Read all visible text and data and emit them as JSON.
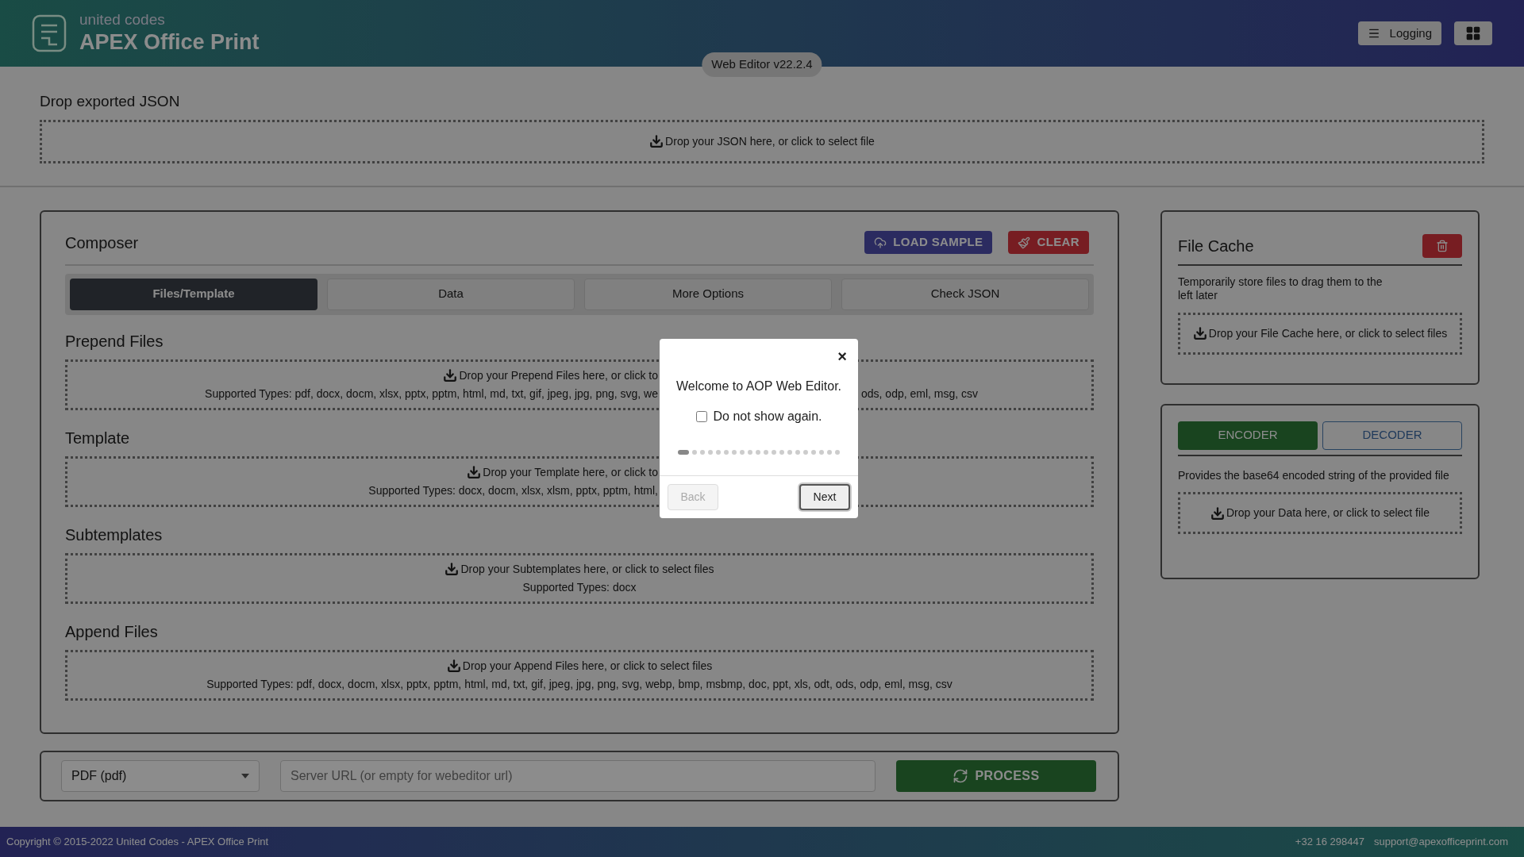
{
  "header": {
    "brand_top": "united codes",
    "brand_name": "APEX Office Print",
    "buttons": [
      {
        "kind": "menu",
        "label": "Logging"
      },
      {
        "kind": "grid"
      }
    ],
    "version": "Web Editor v22.2.4"
  },
  "json_drop": {
    "title": "Drop exported JSON",
    "text": "Drop your JSON here, or click to select file"
  },
  "composer": {
    "title": "Composer",
    "actions": [
      {
        "kind": "load",
        "label": "LOAD SAMPLE"
      },
      {
        "kind": "clear",
        "label": "CLEAR"
      }
    ],
    "tabs": [
      {
        "label": "Files/Template",
        "selected": true
      },
      {
        "label": "Data",
        "selected": false
      },
      {
        "label": "More Options",
        "selected": false
      },
      {
        "label": "Check JSON",
        "selected": false
      }
    ],
    "sections": [
      {
        "title": "Prepend Files",
        "lines": [
          {
            "kind": "hint",
            "left": "Drop your Prepend Files here, or click to"
          },
          {
            "kind": "types",
            "left": "Supported Types: pdf, docx, docm, xlsx, pptx, pptm, html, md, txt, gif, jpeg, jpg, png, svg, we",
            "right": "ods, odp, eml, msg, csv"
          }
        ]
      },
      {
        "title": "Template",
        "lines": [
          {
            "kind": "hint",
            "left": "Drop your Template here, or click to"
          },
          {
            "kind": "types",
            "left": "Supported Types: docx, docm, xlsx, xlsm, pptx, pptm, html,"
          }
        ]
      },
      {
        "title": "Subtemplates",
        "lines": [
          {
            "kind": "hint",
            "text": "Drop your Subtemplates here, or click to select files"
          },
          {
            "kind": "types",
            "text": "Supported Types: docx"
          }
        ]
      },
      {
        "title": "Append Files",
        "lines": [
          {
            "kind": "hint",
            "text": "Drop your Append Files here, or click to select files"
          },
          {
            "kind": "types",
            "text": "Supported Types: pdf, docx, docm, xlsx, pptx, pptm, html, md, txt, gif, jpeg, jpg, png, svg, webp, bmp, msbmp, doc, ppt, xls, odt, ods, odp, eml, msg, csv"
          }
        ]
      }
    ]
  },
  "file_cache": {
    "title": "File Cache",
    "description": "Temporarily store files to drag them to the left later",
    "drop": "Drop your File Cache here, or click to select files"
  },
  "codec": {
    "tabs": [
      {
        "label": "ENCODER",
        "selected": true
      },
      {
        "label": "DECODER",
        "selected": false
      }
    ],
    "description": "Provides the base64 encoded string of the provided file",
    "drop": "Drop your Data here, or click to select file"
  },
  "bottom": {
    "format": "PDF (pdf)",
    "server_url_placeholder": "Server URL (or empty for webeditor url)",
    "process": "PROCESS"
  },
  "footer": {
    "copyright": "Copyright © 2015-2022 United Codes - APEX Office Print",
    "phone": "+32 16 298447",
    "email": "support@apexofficeprint.com"
  },
  "dialog": {
    "close": "×",
    "message": "Welcome to AOP Web Editor.",
    "checkbox": {
      "label": "Do not show again.",
      "checked": false
    },
    "steps": [
      {
        "selected": true
      },
      {
        "selected": false
      },
      {
        "selected": false
      },
      {
        "selected": false
      },
      {
        "selected": false
      },
      {
        "selected": false
      },
      {
        "selected": false
      },
      {
        "selected": false
      },
      {
        "selected": false
      },
      {
        "selected": false
      },
      {
        "selected": false
      },
      {
        "selected": false
      },
      {
        "selected": false
      },
      {
        "selected": false
      },
      {
        "selected": false
      },
      {
        "selected": false
      },
      {
        "selected": false
      },
      {
        "selected": false
      },
      {
        "selected": false
      },
      {
        "selected": false
      }
    ],
    "back": {
      "label": "Back",
      "disabled": true
    },
    "next": {
      "label": "Next",
      "disabled": false
    }
  }
}
